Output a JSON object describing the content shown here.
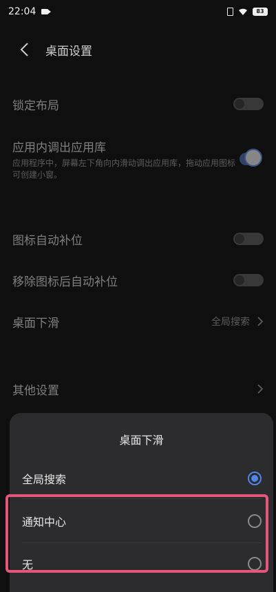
{
  "status_bar": {
    "time": "22:04",
    "battery_level": "83",
    "icons": [
      "video-camera-icon",
      "sim-card-icon",
      "wifi-icon",
      "battery-icon"
    ]
  },
  "header": {
    "title": "桌面设置",
    "back_icon": "back-arrow-icon"
  },
  "settings": {
    "lock_layout": {
      "label": "锁定布局",
      "enabled": false
    },
    "app_library": {
      "label": "应用内调出应用库",
      "description": "应用程序中，屏幕左下角向内滑动调出应用库，拖动应用图标可创建小窗。",
      "enabled": true
    },
    "auto_fill": {
      "label": "图标自动补位",
      "enabled": false
    },
    "auto_fill_after_remove": {
      "label": "移除图标后自动补位",
      "enabled": false
    },
    "swipe_down": {
      "label": "桌面下滑",
      "value": "全局搜索"
    },
    "other": {
      "label": "其他设置"
    }
  },
  "sheet": {
    "title": "桌面下滑",
    "options": [
      {
        "label": "全局搜索",
        "selected": true
      },
      {
        "label": "通知中心",
        "selected": false
      },
      {
        "label": "无",
        "selected": false
      }
    ]
  },
  "colors": {
    "accent": "#4f84e8",
    "highlight": "#e8557a",
    "background": "#0f0f10",
    "sheet": "#2c2c2e"
  }
}
